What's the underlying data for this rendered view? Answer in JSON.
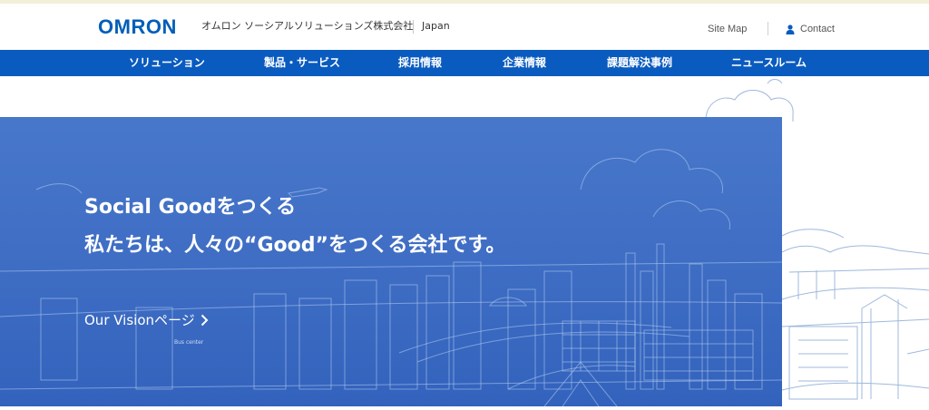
{
  "header": {
    "logo": "OMRON",
    "company_name": "オムロン ソーシアルソリューションズ株式会社",
    "region": "Japan",
    "site_map": "Site Map",
    "contact": "Contact"
  },
  "nav": {
    "items": [
      {
        "label": "ソリューション"
      },
      {
        "label": "製品・サービス"
      },
      {
        "label": "採用情報"
      },
      {
        "label": "企業情報"
      },
      {
        "label": "課題解決事例"
      },
      {
        "label": "ニュースルーム"
      }
    ]
  },
  "hero": {
    "line1": "Social Goodをつくる",
    "line2": "私たちは、人々の“Good”をつくる会社です。",
    "vision_link": "Our Visionページ",
    "bus_sign": "Bus center"
  },
  "colors": {
    "brand": "#005eb8",
    "nav_bg": "#0a5bbf",
    "hero_overlay": "#2e60be",
    "illustration_line": "#9fb8dd"
  },
  "icons": {
    "contact": "person-icon",
    "vision_arrow": "chevron-right-icon"
  }
}
